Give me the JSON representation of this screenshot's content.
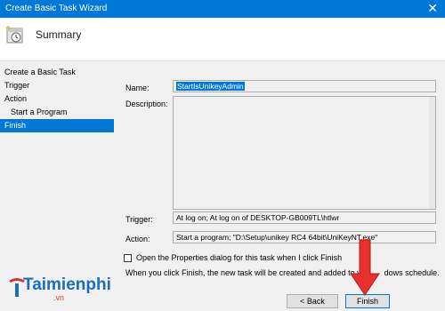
{
  "window": {
    "title": "Create Basic Task Wizard",
    "close_glyph": "✕"
  },
  "header": {
    "title": "Summary",
    "icon": "task-scheduler-icon"
  },
  "sidebar": {
    "items": [
      {
        "label": "Create a Basic Task",
        "active": false,
        "indent": false
      },
      {
        "label": "Trigger",
        "active": false,
        "indent": false
      },
      {
        "label": "Action",
        "active": false,
        "indent": false
      },
      {
        "label": "Start a Program",
        "active": false,
        "indent": true
      },
      {
        "label": "Finish",
        "active": true,
        "indent": false
      }
    ]
  },
  "summary": {
    "name_label": "Name:",
    "name_value": "StartIsUnikeyAdmin",
    "description_label": "Description:",
    "description_value": "",
    "trigger_label": "Trigger:",
    "trigger_value": "At log on; At log on of DESKTOP-GB009TL\\htlwr",
    "action_label": "Action:",
    "action_value": "Start a program; \"D:\\Setup\\unikey RC4 64bit\\UniKeyNT.exe\"",
    "open_properties_label": "Open the Properties dialog for this task when I click Finish",
    "open_properties_checked": false,
    "finish_note": "When you click Finish, the new task will be created and added to y",
    "finish_note_tail": "dows schedule."
  },
  "buttons": {
    "back": "< Back",
    "finish": "Finish"
  },
  "watermark": {
    "brand": "Taimienphi",
    "suffix": ".vn"
  },
  "colors": {
    "accent": "#0078d7",
    "arrow": "#e8302c",
    "brand": "#1b6fb7"
  }
}
